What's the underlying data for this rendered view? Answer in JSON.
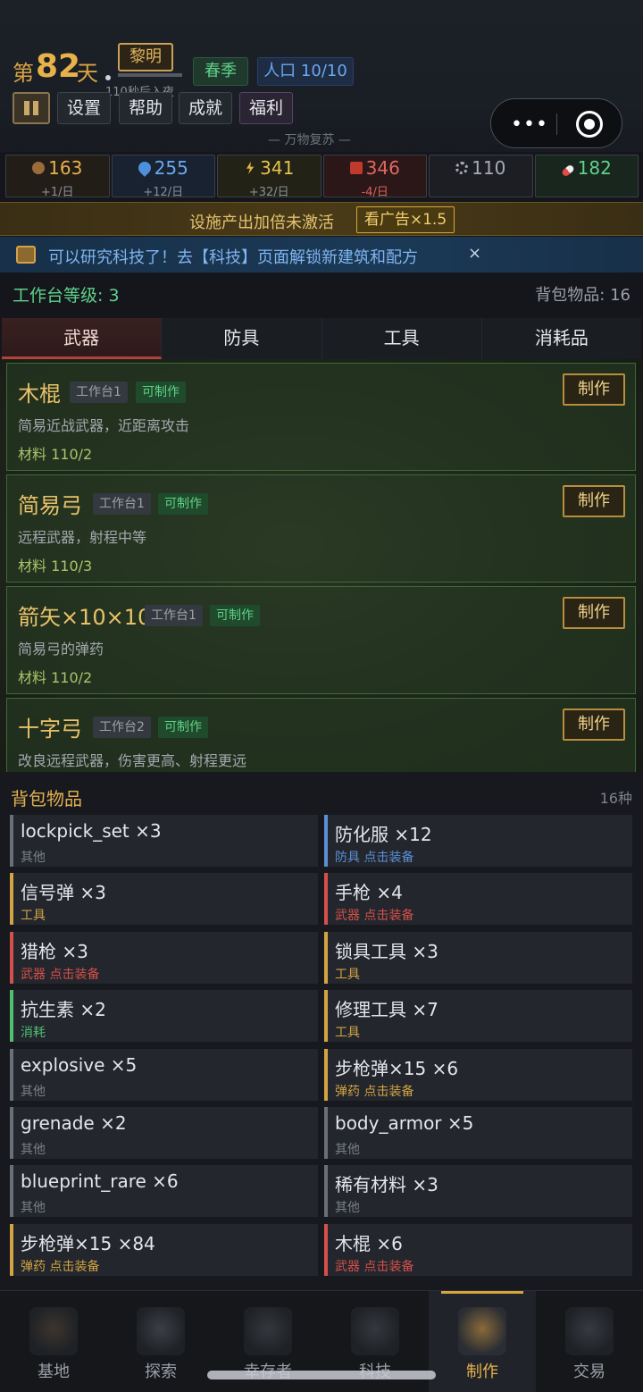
{
  "header": {
    "day_prefix": "第",
    "day_number": "82",
    "day_suffix": "天",
    "phase": "黎明",
    "night_timer": "110秒后入夜",
    "season": "春季",
    "population": "人口 10/10",
    "menu": [
      "设置",
      "帮助",
      "成就",
      "福利"
    ],
    "subtitle": "— 万物复苏 —",
    "capsule_more": "•••"
  },
  "resources": [
    {
      "icon": "food-icon",
      "value": "163",
      "rate": "+1/日",
      "color": "#e6b14c",
      "rate_color": "#8a8f97"
    },
    {
      "icon": "water-icon",
      "value": "255",
      "rate": "+12/日",
      "color": "#6aa8f0",
      "rate_color": "#8a8f97"
    },
    {
      "icon": "energy-icon",
      "value": "341",
      "rate": "+32/日",
      "color": "#e6c24c",
      "rate_color": "#8a8f97"
    },
    {
      "icon": "fuel-icon",
      "value": "346",
      "rate": "-4/日",
      "color": "#e0675f",
      "rate_color": "#d5615a"
    },
    {
      "icon": "gear-icon",
      "value": "110",
      "rate": "",
      "color": "#a7abb2",
      "rate_color": "#8a8f97"
    },
    {
      "icon": "medicine-icon",
      "value": "182",
      "rate": "",
      "color": "#5fd18a",
      "rate_color": "#8a8f97"
    }
  ],
  "boost": {
    "text": "设施产出加倍未激活",
    "button": "看广告×1.5"
  },
  "tech_banner": {
    "text": "可以研究科技了！去【科技】页面解锁新建筑和配方",
    "close": "×"
  },
  "workbench": {
    "level_text": "工作台等级: 3",
    "bag_text": "背包物品: 16"
  },
  "tabs": [
    "武器",
    "防具",
    "工具",
    "消耗品"
  ],
  "recipes": [
    {
      "name": "木棍",
      "workbench": "工作台1",
      "status": "可制作",
      "desc": "简易近战武器，近距离攻击",
      "materials": "材料 110/2",
      "button": "制作"
    },
    {
      "name": "简易弓",
      "workbench": "工作台1",
      "status": "可制作",
      "desc": "远程武器，射程中等",
      "materials": "材料 110/3",
      "button": "制作"
    },
    {
      "name": "箭矢×10×10",
      "workbench": "工作台1",
      "status": "可制作",
      "desc": "简易弓的弹药",
      "materials": "材料 110/2",
      "button": "制作"
    },
    {
      "name": "十字弓",
      "workbench": "工作台2",
      "status": "可制作",
      "desc": "改良远程武器，伤害更高、射程更远",
      "materials": "",
      "button": "制作"
    }
  ],
  "bag": {
    "title": "背包物品",
    "kinds": "16种",
    "items": [
      {
        "name": "lockpick_set ×3",
        "sub": "其他",
        "color": "#6b6f77"
      },
      {
        "name": "防化服 ×12",
        "sub": "防具 点击装备",
        "color": "#5b8fd6"
      },
      {
        "name": "信号弹 ×3",
        "sub": "工具",
        "color": "#d3a443"
      },
      {
        "name": "手枪 ×4",
        "sub": "武器 点击装备",
        "color": "#d5504a"
      },
      {
        "name": "猎枪 ×3",
        "sub": "武器 点击装备",
        "color": "#d5504a"
      },
      {
        "name": "锁具工具 ×3",
        "sub": "工具",
        "color": "#d3a443"
      },
      {
        "name": "抗生素 ×2",
        "sub": "消耗",
        "color": "#4fbf72"
      },
      {
        "name": "修理工具 ×7",
        "sub": "工具",
        "color": "#d3a443"
      },
      {
        "name": "explosive ×5",
        "sub": "其他",
        "color": "#6b6f77"
      },
      {
        "name": "步枪弹×15 ×6",
        "sub": "弹药 点击装备",
        "color": "#d3a443"
      },
      {
        "name": "grenade ×2",
        "sub": "其他",
        "color": "#6b6f77"
      },
      {
        "name": "body_armor ×5",
        "sub": "其他",
        "color": "#6b6f77"
      },
      {
        "name": "blueprint_rare ×6",
        "sub": "其他",
        "color": "#6b6f77"
      },
      {
        "name": "稀有材料 ×3",
        "sub": "其他",
        "color": "#6b6f77"
      },
      {
        "name": "步枪弹×15 ×84",
        "sub": "弹药 点击装备",
        "color": "#d3a443"
      },
      {
        "name": "木棍 ×6",
        "sub": "武器 点击装备",
        "color": "#d5504a"
      }
    ]
  },
  "nav": [
    {
      "label": "基地",
      "icon": "base-icon"
    },
    {
      "label": "探索",
      "icon": "compass-icon"
    },
    {
      "label": "幸存者",
      "icon": "survivors-icon"
    },
    {
      "label": "科技",
      "icon": "tech-gear-icon"
    },
    {
      "label": "制作",
      "icon": "crafting-icon"
    },
    {
      "label": "交易",
      "icon": "trade-icon"
    }
  ],
  "nav_active": "制作"
}
